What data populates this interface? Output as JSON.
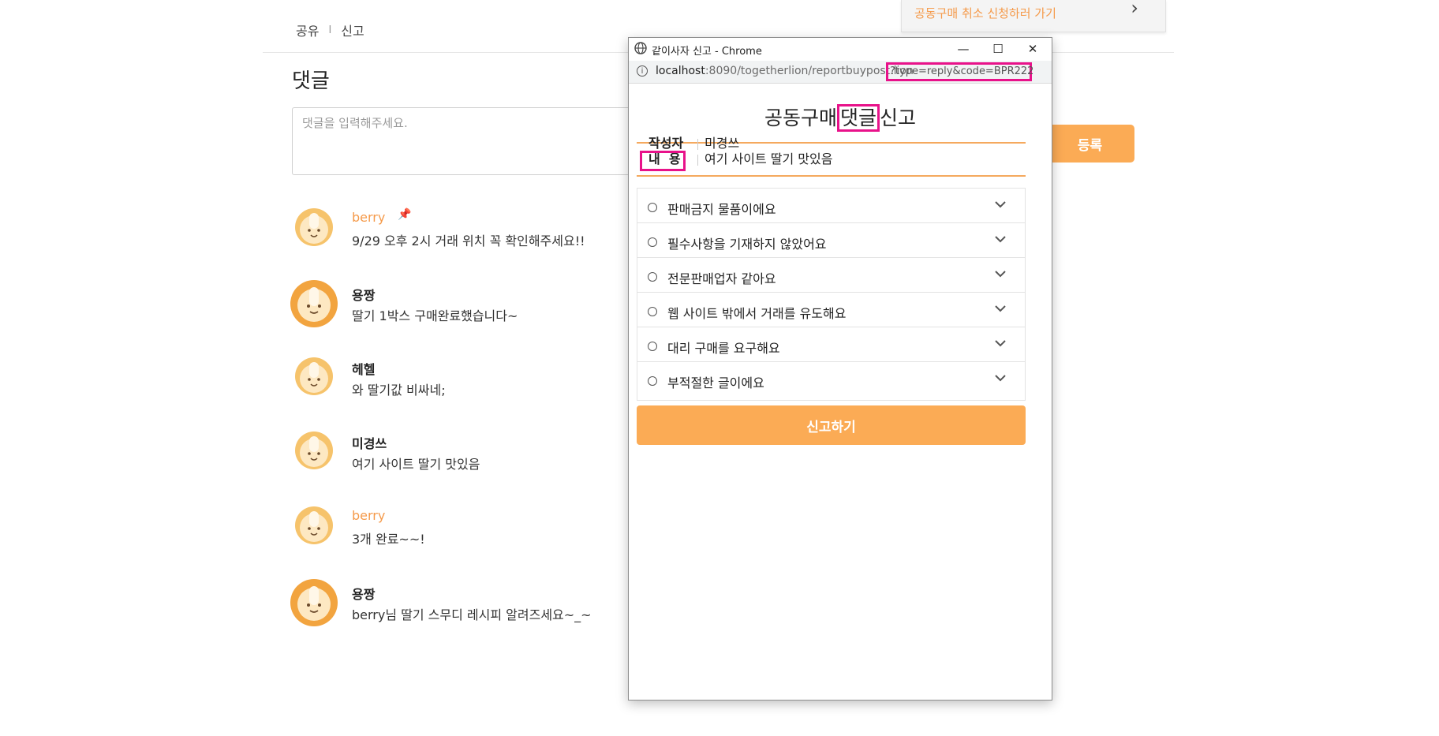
{
  "top_links": {
    "share": "공유",
    "separator": "I",
    "report": "신고"
  },
  "cancel_card": {
    "text": "공동구매 취소 신청하러 가기",
    "chevron": "›"
  },
  "comments_section": {
    "title": "댓글",
    "input_placeholder": "댓글을 입력해주세요.",
    "submit_label": "등록",
    "items": [
      {
        "name": "berry",
        "text": "9/29 오후 2시 거래 위치 꼭 확인해주세요!!",
        "pinned": true
      },
      {
        "name": "용짱",
        "text": "딸기 1박스 구매완료했습니다~"
      },
      {
        "name": "헤헬",
        "text": "와 딸기값 비싸네;"
      },
      {
        "name": "미경쓰",
        "text": "여기 사이트 딸기 맛있음"
      },
      {
        "name": "berry",
        "text": "3개 완료~~!"
      },
      {
        "name": "용짱",
        "text": "berry님 딸기 스무디 레시피 알려즈세요~_~"
      }
    ]
  },
  "popup": {
    "window_title": "같이사자 신고 - Chrome",
    "controls": {
      "minimize": "—",
      "maximize": "☐",
      "close": "✕"
    },
    "url_host": "localhost",
    "url_rest": ":8090/togetherlion/reportbuypost.lion",
    "url_query": "?type=reply&code=BPR222",
    "title_pre": "공동구매",
    "title_highlight": "댓글",
    "title_post": "신고",
    "writer_label": "작성자",
    "writer_value": "미경쓰",
    "content_label": "내  용",
    "content_value": "여기 사이트 딸기 맛있음",
    "reasons": [
      "판매금지 물품이에요",
      "필수사항을 기재하지 않았어요",
      "전문판매업자 같아요",
      "웹 사이트 밖에서 거래를 유도해요",
      "대리 구매를 요구해요",
      "부적절한 글이에요"
    ],
    "report_button": "신고하기"
  },
  "colors": {
    "accent": "#fbab55",
    "name_orange": "#f59a4a",
    "highlight": "#e8128a"
  }
}
